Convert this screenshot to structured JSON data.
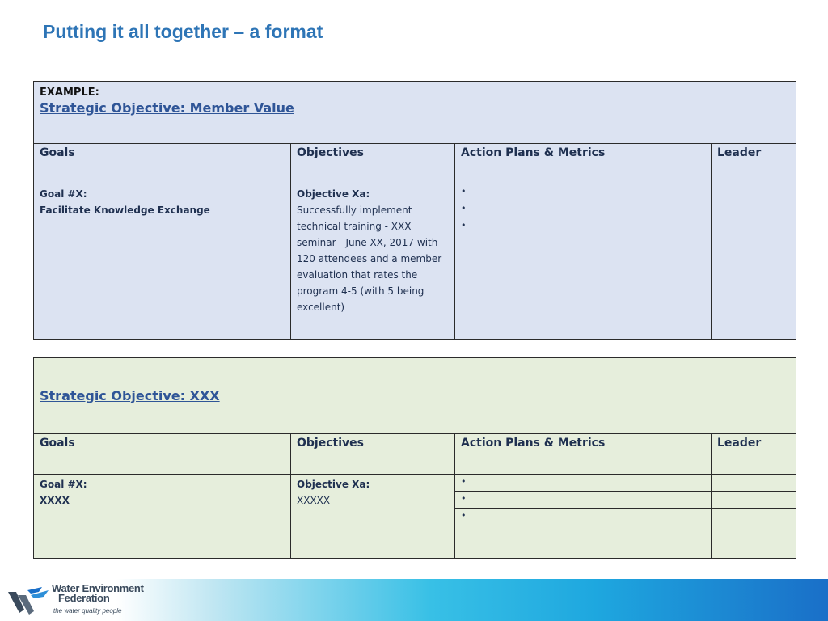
{
  "slide": {
    "title": "Putting it all together – a format"
  },
  "tables": [
    {
      "example_label": "EXAMPLE:",
      "strategic_objective": "Strategic Objective:  Member Value",
      "headers": {
        "goals": "Goals",
        "objectives": "Objectives",
        "action_plans": "Action Plans & Metrics",
        "leader": "Leader"
      },
      "goal_label": "Goal #X:",
      "goal_text": "Facilitate Knowledge Exchange",
      "objective_label": "Objective Xa:",
      "objective_text": "Successfully implement technical training - XXX seminar - June XX, 2017 with 120 attendees and a member evaluation that rates the program 4-5 (with 5 being excellent)",
      "bullets": [
        "•",
        "•",
        "•"
      ]
    },
    {
      "example_label": "",
      "strategic_objective": "Strategic Objective:  XXX",
      "headers": {
        "goals": "Goals",
        "objectives": "Objectives",
        "action_plans": "Action Plans & Metrics",
        "leader": "Leader"
      },
      "goal_label": "Goal #X:",
      "goal_text": "XXXX",
      "objective_label": "Objective Xa:",
      "objective_text": "XXXXX",
      "bullets": [
        "•",
        "•",
        "•"
      ]
    }
  ],
  "footer": {
    "logo_line1": "Water Environment",
    "logo_line2": "Federation",
    "logo_tagline": "the water quality people",
    "logo_colors": {
      "dark": "#3a4a5c",
      "accent": "#1a6fc8"
    }
  }
}
